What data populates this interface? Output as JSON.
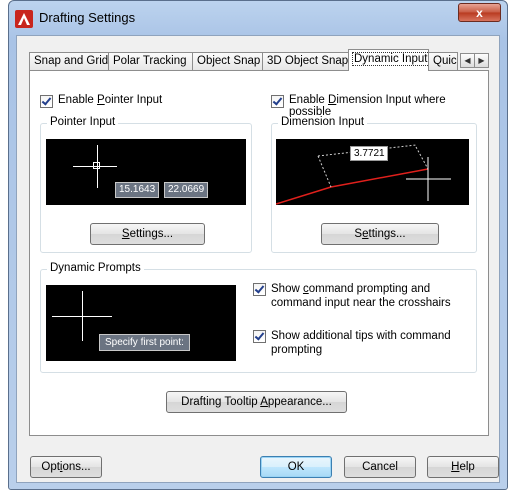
{
  "window": {
    "title": "Drafting Settings",
    "close_glyph": "x",
    "icon": "autocad-logo-icon"
  },
  "tabs": [
    {
      "label": "Snap and Grid"
    },
    {
      "label": "Polar Tracking"
    },
    {
      "label": "Object Snap"
    },
    {
      "label": "3D Object Snap"
    },
    {
      "label": "Dynamic Input",
      "active": true
    },
    {
      "label": "Quic"
    }
  ],
  "tab_scroll": {
    "left": "◀",
    "right": "▶"
  },
  "pointer": {
    "enable_pre": "Enable ",
    "enable_key": "P",
    "enable_post": "ointer Input",
    "enabled": true,
    "group_label": "Pointer Input",
    "coord_x": "15.1643",
    "coord_y": "22.0669",
    "settings_key": "S",
    "settings_rest": "ettings..."
  },
  "dimension": {
    "enable_pre": "Enable ",
    "enable_key": "D",
    "enable_post": "imension Input where possible",
    "enabled": true,
    "group_label": "Dimension Input",
    "value": "3.7721",
    "settings_pre": "S",
    "settings_key": "e",
    "settings_rest": "ttings..."
  },
  "prompts": {
    "group_label": "Dynamic Prompts",
    "prompt_text": "Specify first point:",
    "show_cmd_pre": "Show ",
    "show_cmd_key": "c",
    "show_cmd_post": "ommand prompting and",
    "show_cmd_line2": "command input near the crosshairs",
    "show_cmd_checked": true,
    "show_tips_line1": "Show additional tips with command",
    "show_tips_line2": "prompting",
    "show_tips_checked": true
  },
  "tooltip_button": {
    "pre": "Drafting Tooltip ",
    "key": "A",
    "post": "ppearance..."
  },
  "footer": {
    "options_pre": "Opt",
    "options_key": "i",
    "options_post": "ons...",
    "ok": "OK",
    "cancel": "Cancel",
    "help_key": "H",
    "help_post": "elp"
  },
  "colors": {
    "dimension_line": "#e0201c",
    "preview_bg": "#000000",
    "coord_box_bg": "#6b7482",
    "active_tab_bg": "#ffffff"
  }
}
